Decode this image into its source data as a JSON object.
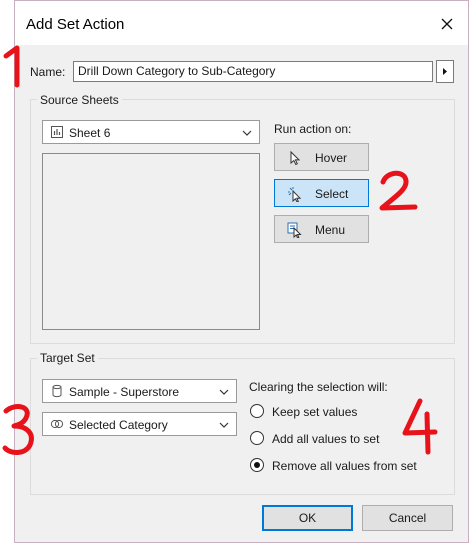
{
  "dialog": {
    "title": "Add Set Action",
    "name_label": "Name:",
    "name_value": "Drill Down Category to Sub-Category"
  },
  "source_sheets": {
    "legend": "Source Sheets",
    "sheet_dropdown": "Sheet 6",
    "run_action_label": "Run action on:",
    "buttons": [
      {
        "label": "Hover",
        "icon": "pointer-icon",
        "selected": false
      },
      {
        "label": "Select",
        "icon": "select-cursor-icon",
        "selected": true
      },
      {
        "label": "Menu",
        "icon": "menu-cursor-icon",
        "selected": false
      }
    ]
  },
  "target_set": {
    "legend": "Target Set",
    "datasource_dropdown": "Sample - Superstore",
    "set_dropdown": "Selected Category",
    "clearing_label": "Clearing the selection will:",
    "options": [
      {
        "label": "Keep set values",
        "checked": false
      },
      {
        "label": "Add all values to set",
        "checked": false
      },
      {
        "label": "Remove all values from set",
        "checked": true
      }
    ]
  },
  "footer": {
    "ok_label": "OK",
    "cancel_label": "Cancel"
  },
  "annotations": [
    "1",
    "2",
    "3",
    "4"
  ],
  "colors": {
    "annotation": "#e8131a",
    "selected_button": "#cce4f7",
    "focus_border": "#0078d7"
  }
}
